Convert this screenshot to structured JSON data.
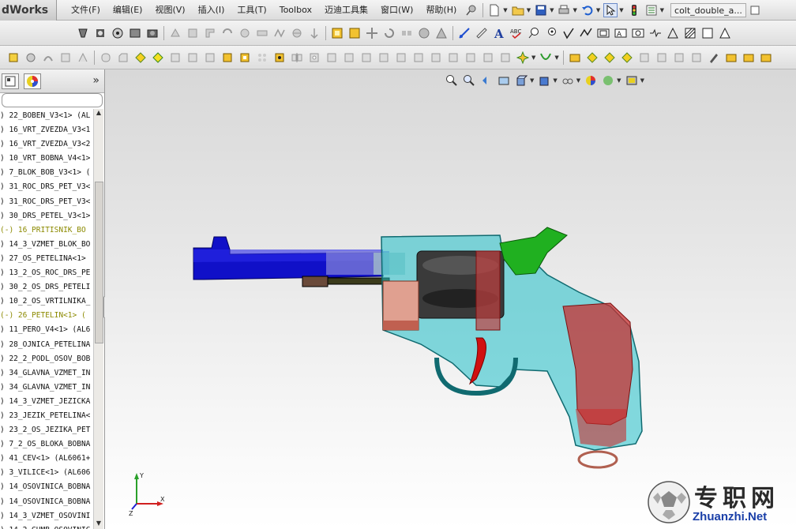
{
  "app": {
    "logo_text": "dWorks",
    "document_title": "colt_double_a..."
  },
  "menu": [
    {
      "label": "文件(F)"
    },
    {
      "label": "编辑(E)"
    },
    {
      "label": "视图(V)"
    },
    {
      "label": "插入(I)"
    },
    {
      "label": "工具(T)"
    },
    {
      "label": "Toolbox"
    },
    {
      "label": "迈迪工具集"
    },
    {
      "label": "窗口(W)"
    },
    {
      "label": "帮助(H)"
    }
  ],
  "tree": {
    "expand_glyph": "»",
    "items": [
      {
        "text": ") 22_BOBEN_V3<1> (AL",
        "highlight": false
      },
      {
        "text": ") 16_VRT_ZVEZDA_V3<1",
        "highlight": false
      },
      {
        "text": ") 16_VRT_ZVEZDA_V3<2",
        "highlight": false
      },
      {
        "text": ") 10_VRT_BOBNA_V4<1>",
        "highlight": false
      },
      {
        "text": ") 7_BLOK_BOB_V3<1> (",
        "highlight": false
      },
      {
        "text": ") 31_ROC_DRS_PET_V3<",
        "highlight": false
      },
      {
        "text": ") 31_ROC_DRS_PET_V3<",
        "highlight": false
      },
      {
        "text": ") 30_DRS_PETEL_V3<1>",
        "highlight": false
      },
      {
        "text": "(-) 16_PRITISNIK_BO",
        "highlight": true
      },
      {
        "text": ") 14_3_VZMET_BLOK_BO",
        "highlight": false
      },
      {
        "text": ") 27_OS_PETELINA<1>",
        "highlight": false
      },
      {
        "text": ") 13_2_OS_ROC_DRS_PE",
        "highlight": false
      },
      {
        "text": ") 30_2_OS_DRS_PETELI",
        "highlight": false
      },
      {
        "text": ") 10_2_OS_VRTILNIKA_",
        "highlight": false
      },
      {
        "text": "(-) 26_PETELIN<1> (",
        "highlight": true
      },
      {
        "text": ") 11_PERO_V4<1> (AL6",
        "highlight": false
      },
      {
        "text": ") 28_OJNICA_PETELINA",
        "highlight": false
      },
      {
        "text": ") 22_2_PODL_OSOV_BOB",
        "highlight": false
      },
      {
        "text": ") 34_GLAVNA_VZMET_IN",
        "highlight": false
      },
      {
        "text": ") 34_GLAVNA_VZMET_IN",
        "highlight": false
      },
      {
        "text": ") 14_3_VZMET_JEZICKA",
        "highlight": false
      },
      {
        "text": ") 23_JEZIK_PETELINA<",
        "highlight": false
      },
      {
        "text": ") 23_2_OS_JEZIKA_PET",
        "highlight": false
      },
      {
        "text": ") 7_2_OS_BLOKA_BOBNA",
        "highlight": false
      },
      {
        "text": ") 41_CEV<1> (AL6061+",
        "highlight": false
      },
      {
        "text": ") 3_VILICE<1> (AL606",
        "highlight": false
      },
      {
        "text": ") 14_OSOVINICA_BOBNA",
        "highlight": false
      },
      {
        "text": ") 14_OSOVINICA_BOBNA",
        "highlight": false
      },
      {
        "text": ") 14_3_VZMET_OSOVINI",
        "highlight": false
      },
      {
        "text": ") 14_2_GUMB_OSOVINIC",
        "highlight": false
      }
    ]
  },
  "triad": {
    "x_label": "X",
    "y_label": "Y",
    "z_label": "Z"
  },
  "watermark": {
    "cn": "专职网",
    "en": "Zhuanzhi.Net"
  }
}
